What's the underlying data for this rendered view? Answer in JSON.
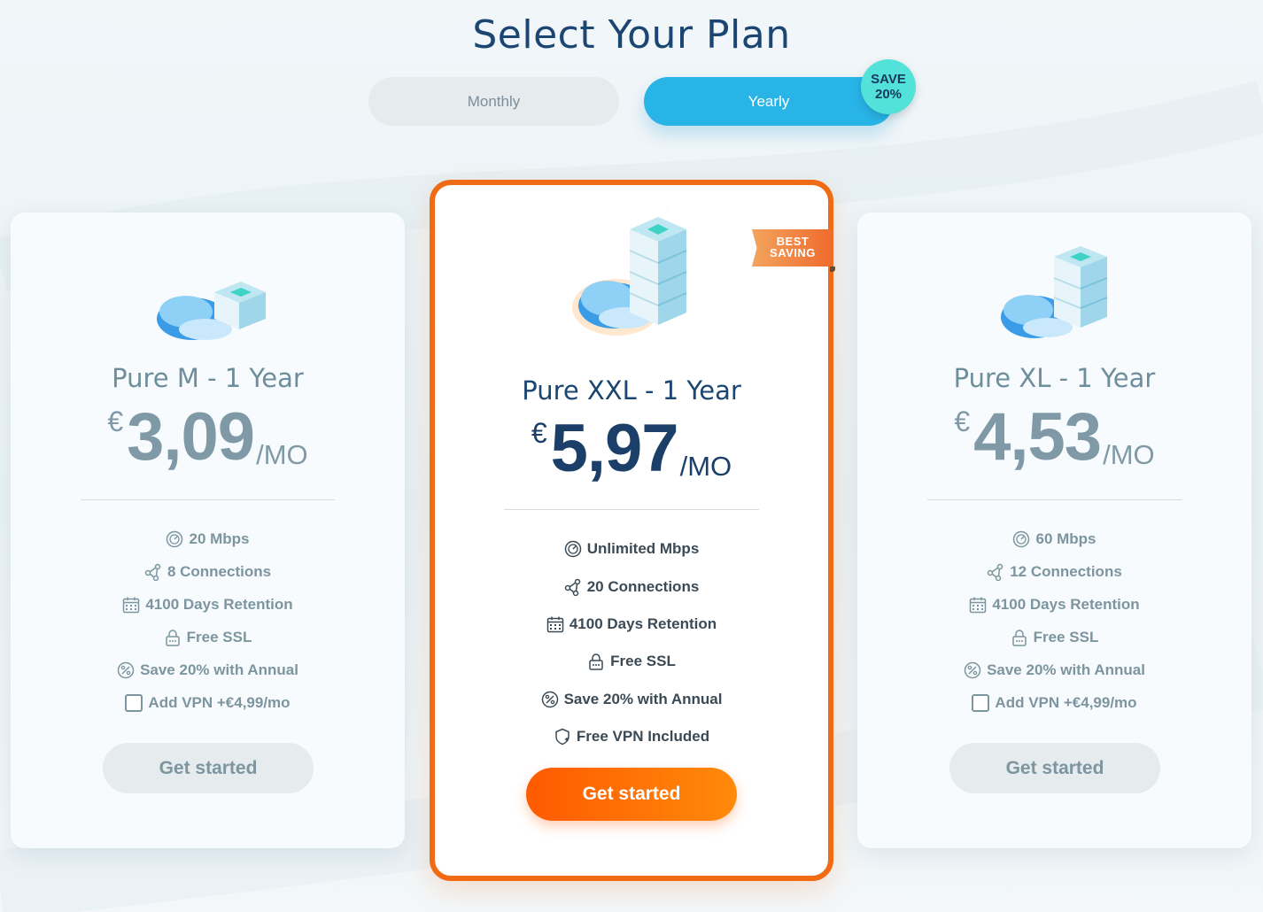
{
  "header": {
    "title": "Select Your Plan"
  },
  "billing_toggle": {
    "monthly_label": "Monthly",
    "yearly_label": "Yearly",
    "selected": "Yearly",
    "save_badge_line1": "SAVE",
    "save_badge_line2": "20%"
  },
  "plans": [
    {
      "name": "Pure M - 1 Year",
      "currency": "€",
      "price": "3,09",
      "period": "/MO",
      "features": [
        "20 Mbps",
        "8 Connections",
        "4100 Days Retention",
        "Free SSL",
        "Save 20% with Annual"
      ],
      "vpn_addon": "Add VPN +€4,99/mo",
      "cta": "Get started"
    },
    {
      "name": "Pure XXL - 1 Year",
      "currency": "€",
      "price": "5,97",
      "period": "/MO",
      "ribbon_line1": "BEST",
      "ribbon_line2": "SAVING",
      "features": [
        "Unlimited Mbps",
        "20 Connections",
        "4100 Days Retention",
        "Free SSL",
        "Save 20% with Annual",
        "Free VPN Included"
      ],
      "cta": "Get started"
    },
    {
      "name": "Pure XL - 1 Year",
      "currency": "€",
      "price": "4,53",
      "period": "/MO",
      "features": [
        "60 Mbps",
        "12 Connections",
        "4100 Days Retention",
        "Free SSL",
        "Save 20% with Annual"
      ],
      "vpn_addon": "Add VPN +€4,99/mo",
      "cta": "Get started"
    }
  ],
  "colors": {
    "title": "#1c4672",
    "toggle_active": "#28b4e6",
    "save_badge": "#52e2d9",
    "featured_border": "#f06b14",
    "cta_primary": "#ff6a00",
    "muted_text": "#7c959f"
  },
  "icons": [
    "speedometer-icon",
    "share-nodes-icon",
    "calendar-icon",
    "lock-icon",
    "percent-icon",
    "shield-icon",
    "cloud-server-illustration"
  ]
}
